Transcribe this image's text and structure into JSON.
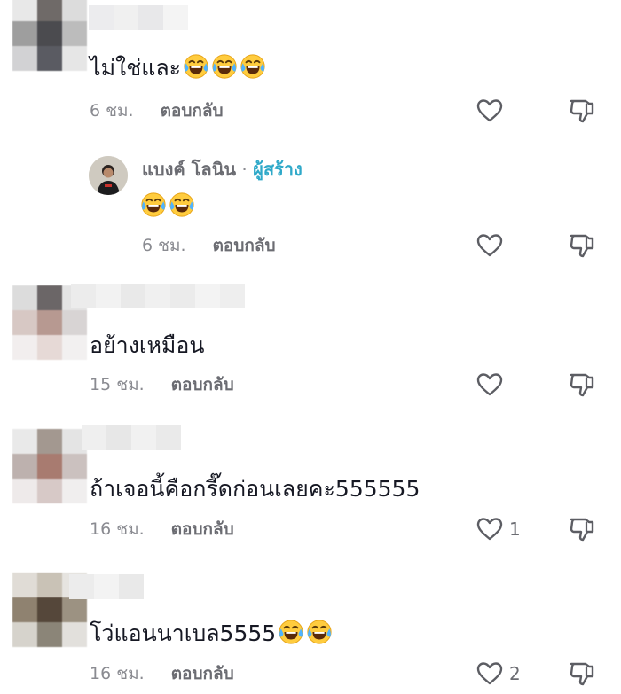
{
  "comments": [
    {
      "text": "ไม่ใช่และ",
      "emoji_count": 3,
      "time": "6 ชม.",
      "reply_label": "ตอบกลับ",
      "likes": ""
    },
    {
      "author": "แบงค์ โลนิน",
      "separator": "·",
      "badge": "ผู้สร้าง",
      "text": "",
      "emoji_count": 2,
      "time": "6 ชม.",
      "reply_label": "ตอบกลับ",
      "likes": ""
    },
    {
      "text": "อย้างเหมือน",
      "time": "15 ชม.",
      "reply_label": "ตอบกลับ",
      "likes": ""
    },
    {
      "text": "ถ้าเจอนี้คือกรี๊ดก่อนเลยคะ555555",
      "time": "16 ชม.",
      "reply_label": "ตอบกลับ",
      "likes": "1"
    },
    {
      "text": "โว่แอนนาเบล5555",
      "emoji_count": 2,
      "time": "16 ชม.",
      "reply_label": "ตอบกลับ",
      "likes": "2"
    }
  ],
  "icons": {
    "like": "heart-outline-icon",
    "dislike": "thumbs-down-outline-icon",
    "emoji": "face-with-tears-of-joy-icon"
  },
  "colors": {
    "text": "#161823",
    "meta": "#8a8b91",
    "creator_badge": "#2fa9c9"
  }
}
